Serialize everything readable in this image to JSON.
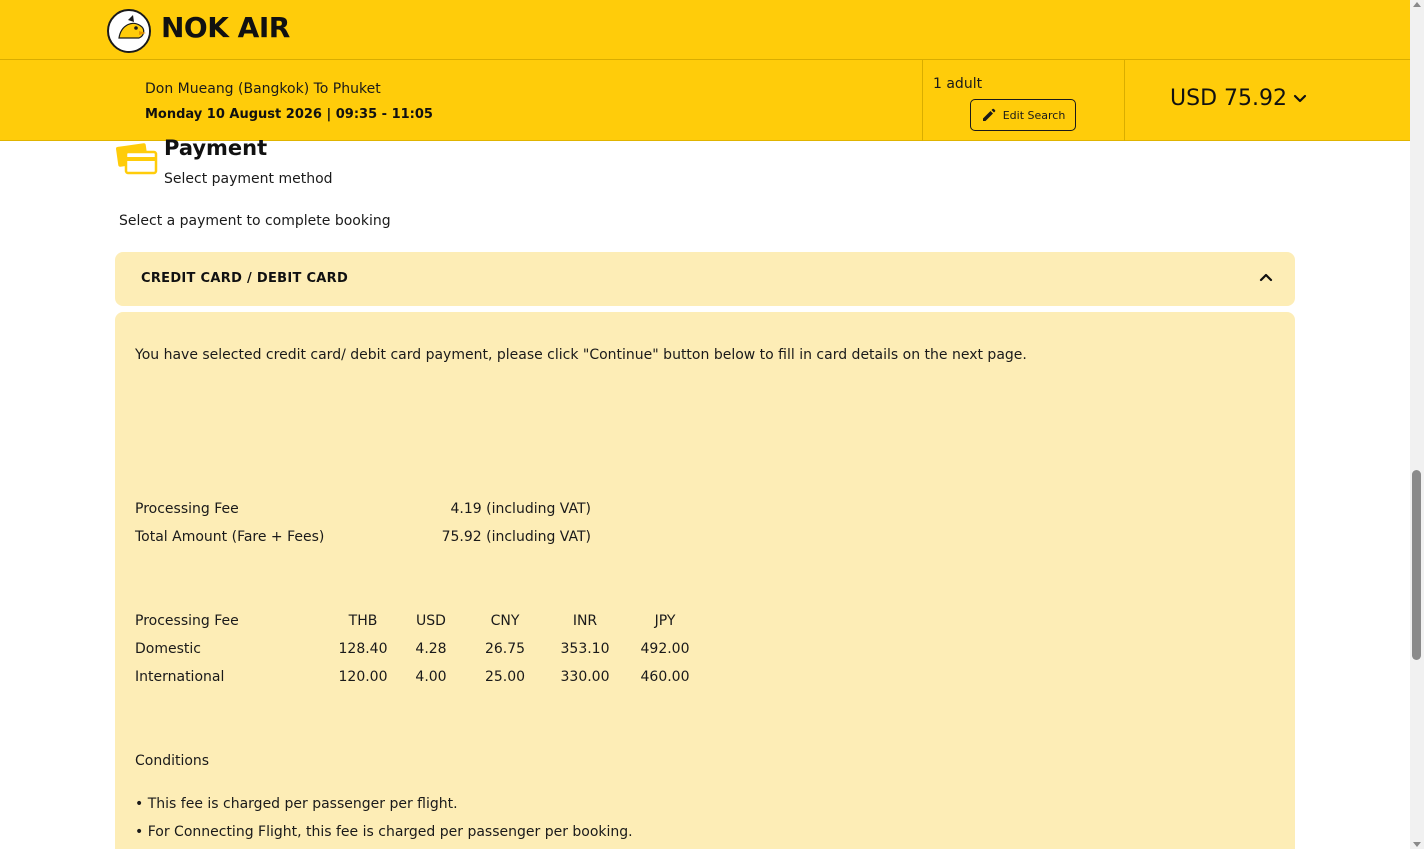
{
  "brand": {
    "name": "NOK AIR",
    "logo_text": "nok",
    "color": "#ffcc0a"
  },
  "search": {
    "route": "Don Mueang (Bangkok) To Phuket",
    "datetime": "Monday 10 August 2026 | 09:35 - 11:05",
    "passengers": "1 adult",
    "edit_label": "Edit Search",
    "price": "USD 75.92"
  },
  "payment": {
    "title": "Payment",
    "subtitle": "Select payment method",
    "intro": "Select a payment to complete booking",
    "method_title": "CREDIT CARD / DEBIT CARD",
    "selected_note": "You have selected credit card/ debit card payment, please click \"Continue\" button below to fill in card details on the next page.",
    "summary": [
      {
        "label": "Processing Fee",
        "value": "4.19 (including VAT)"
      },
      {
        "label": "Total Amount (Fare + Fees)",
        "value": "75.92 (including VAT)"
      }
    ],
    "fee_table": {
      "headers": [
        "Processing Fee",
        "THB",
        "USD",
        "CNY",
        "INR",
        "JPY"
      ],
      "rows": [
        [
          "Domestic",
          "128.40",
          "4.28",
          "26.75",
          "353.10",
          "492.00"
        ],
        [
          "International",
          "120.00",
          "4.00",
          "25.00",
          "330.00",
          "460.00"
        ]
      ]
    },
    "conditions_title": "Conditions",
    "conditions": [
      "This fee is charged per passenger per flight.",
      "For Connecting Flight, this fee is charged per passenger per booking."
    ]
  }
}
